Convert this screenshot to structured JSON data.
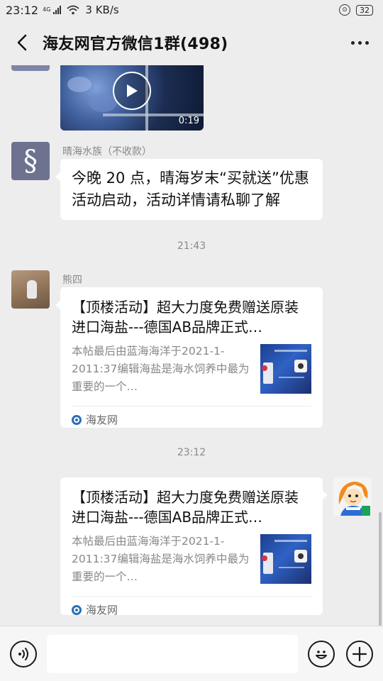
{
  "status_bar": {
    "time": "23:12",
    "network": "4G",
    "speed": "3 KB/s",
    "battery": "32"
  },
  "header": {
    "title": "海友网官方微信1群(498)"
  },
  "messages": {
    "video": {
      "duration": "0:19"
    },
    "msg1": {
      "sender": "晴海水族（不收款）",
      "text": "今晚 20 点，晴海岁末“买就送”优惠活动启动，活动详情请私聊了解"
    },
    "time1": "21:43",
    "msg2": {
      "sender": "熊四",
      "card_title": "【顶楼活动】超大力度免费赠送原装进口海盐---德国AB品牌正式…",
      "card_desc": "本帖最后由蓝海海洋于2021-1-2011:37编辑海盐是海水饲养中最为重要的一个…",
      "source": "海友网"
    },
    "time2": "23:12",
    "msg3": {
      "card_title": "【顶楼活动】超大力度免费赠送原装进口海盐---德国AB品牌正式…",
      "card_desc": "本帖最后由蓝海海洋于2021-1-2011:37编辑海盐是海水饲养中最为重要的一个…",
      "source": "海友网"
    }
  },
  "input": {
    "value": "",
    "placeholder": ""
  },
  "icons": {
    "back": "back-arrow-icon",
    "more": "more-icon",
    "voice": "voice-icon",
    "emoji": "emoji-icon",
    "plus": "plus-icon",
    "play": "play-icon"
  }
}
